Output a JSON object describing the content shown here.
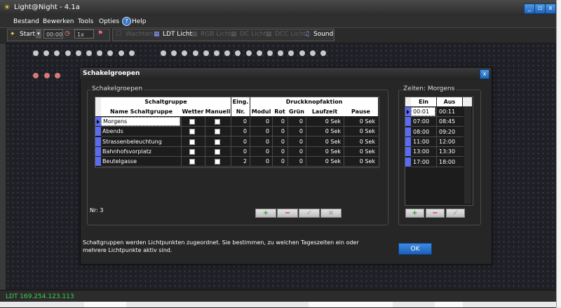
{
  "app": {
    "title": "Light@Night - 4.1a"
  },
  "window_buttons": [
    "_",
    "▫",
    "x"
  ],
  "menu": [
    "Bestand",
    "Bewerken",
    "Tools",
    "Opties",
    "Help"
  ],
  "toolbar": {
    "start_label": "Start",
    "time_value": "00:00",
    "speed_value": "1x",
    "items": [
      {
        "label": "Wachten",
        "enabled": false
      },
      {
        "label": "LDT Licht",
        "enabled": true
      },
      {
        "label": "RGB Licht",
        "enabled": false
      },
      {
        "label": "DC Licht",
        "enabled": false
      },
      {
        "label": "DCC Licht",
        "enabled": false
      },
      {
        "label": "Sound",
        "enabled": true
      }
    ]
  },
  "canvas": {
    "grey_dot_count": 26,
    "red_dot_count": 3,
    "grey_color": "#c9c9c9",
    "red_color": "#d77a7a"
  },
  "dialog": {
    "title": "Schakelgroepen",
    "close_label": "x",
    "left_group_label": "Schakelgroepen",
    "right_group_label": "Zeiten: Morgens",
    "headers": {
      "schaltgruppe": "Schaltgruppe",
      "name": "Name Schaltgruppe",
      "wetter": "Wetter",
      "manuell": "Manuell",
      "eing": "Eing.",
      "nr": "Nr.",
      "druckknopf": "Druckknopfaktion",
      "modul": "Modul",
      "rot": "Rot",
      "gruen": "Grün",
      "laufzeit": "Laufzeit",
      "pause": "Pause"
    },
    "rows": [
      {
        "name": "Morgens",
        "eing": "0",
        "modul": "0",
        "rot": "0",
        "gruen": "0",
        "laufzeit": "0 Sek",
        "pause": "0 Sek"
      },
      {
        "name": "Abends",
        "eing": "0",
        "modul": "0",
        "rot": "0",
        "gruen": "0",
        "laufzeit": "0 Sek",
        "pause": "0 Sek"
      },
      {
        "name": "Strassenbeleuchtung",
        "eing": "0",
        "modul": "0",
        "rot": "0",
        "gruen": "0",
        "laufzeit": "0 Sek",
        "pause": "0 Sek"
      },
      {
        "name": "Bahnhofsvorplatz",
        "eing": "0",
        "modul": "0",
        "rot": "0",
        "gruen": "0",
        "laufzeit": "0 Sek",
        "pause": "0 Sek"
      },
      {
        "name": "Beutelgasse",
        "eing": "2",
        "modul": "0",
        "rot": "0",
        "gruen": "0",
        "laufzeit": "0 Sek",
        "pause": "0 Sek"
      }
    ],
    "nr_text": "Nr: 3",
    "grid_buttons": [
      "+",
      "−",
      "✓",
      "×"
    ],
    "times_headers": {
      "ein": "Ein",
      "aus": "Aus"
    },
    "times": [
      {
        "ein": "00:01",
        "aus": "00:11"
      },
      {
        "ein": "07:00",
        "aus": "08:45"
      },
      {
        "ein": "08:00",
        "aus": "09:20"
      },
      {
        "ein": "11:00",
        "aus": "12:00"
      },
      {
        "ein": "13:00",
        "aus": "13:30"
      },
      {
        "ein": "17:00",
        "aus": "18:00"
      }
    ],
    "times_buttons": [
      "+",
      "−",
      "✓"
    ],
    "info_text": "Schaltgruppen werden Lichtpunkten zugeordnet. Sie bestimmen, zu welchen Tageszeiten ein oder mehrere Lichtpunkte aktiv sind.",
    "ok_label": "OK"
  },
  "status": {
    "text": "LDT 169.254.123.113"
  },
  "colors": {
    "accent": "#1f64b9",
    "status_green": "#39d04a",
    "indicator": "#5b6cf0"
  }
}
